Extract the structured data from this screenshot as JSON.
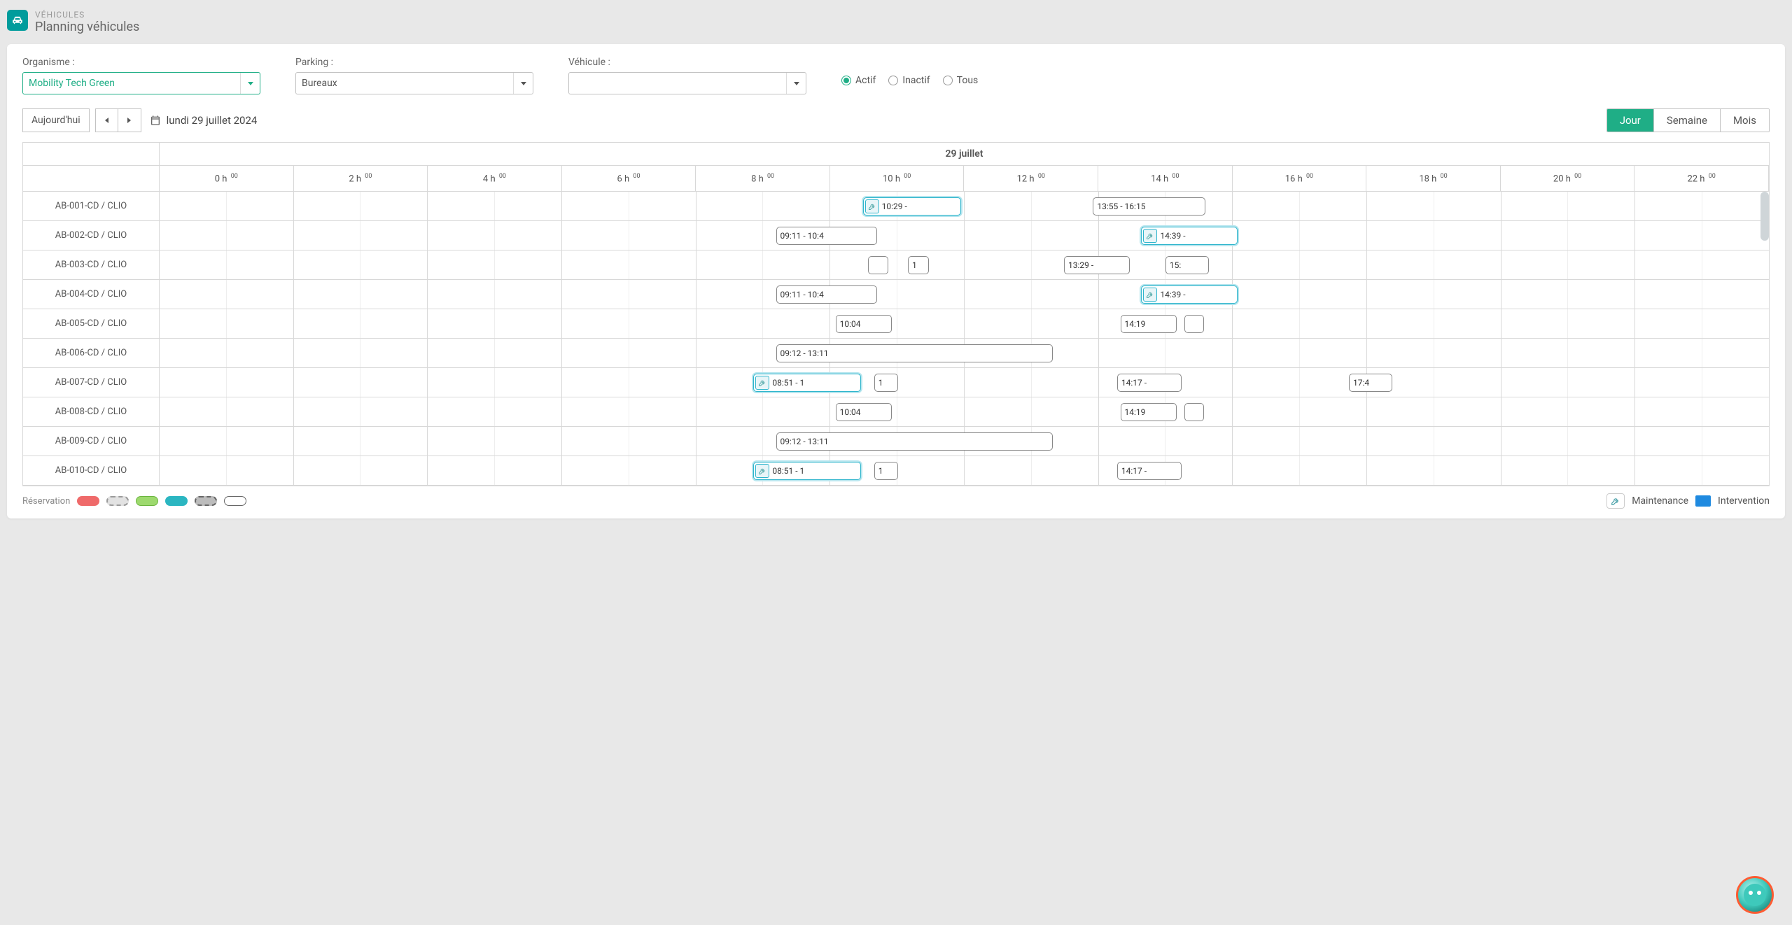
{
  "header": {
    "breadcrumb": "VÉHICULES",
    "title": "Planning véhicules"
  },
  "filters": {
    "org": {
      "label": "Organisme :",
      "value": "Mobility Tech Green"
    },
    "parking": {
      "label": "Parking :",
      "value": "Bureaux"
    },
    "vehicle": {
      "label": "Véhicule :",
      "value": ""
    },
    "radios": [
      {
        "label": "Actif",
        "checked": true
      },
      {
        "label": "Inactif",
        "checked": false
      },
      {
        "label": "Tous",
        "checked": false
      }
    ]
  },
  "toolbar": {
    "today": "Aujourd'hui",
    "date": "lundi 29 juillet 2024",
    "views": [
      "Jour",
      "Semaine",
      "Mois"
    ],
    "activeView": "Jour"
  },
  "scheduler": {
    "dayLabel": "29 juillet",
    "hours": [
      "0 h",
      "2 h",
      "4 h",
      "6 h",
      "8 h",
      "10 h",
      "12 h",
      "14 h",
      "16 h",
      "18 h",
      "20 h",
      "22 h"
    ],
    "hourSup": "00",
    "rows": [
      {
        "name": "AB-001-CD / CLIO",
        "bars": [
          {
            "label": "10:29 -",
            "startPct": 43.7,
            "widthPct": 6.1,
            "maint": true
          },
          {
            "label": "13:55 - 16:15",
            "startPct": 58.0,
            "widthPct": 7.0,
            "maint": false
          }
        ]
      },
      {
        "name": "AB-002-CD / CLIO",
        "bars": [
          {
            "label": "09:11 - 10:4",
            "startPct": 38.3,
            "widthPct": 6.3,
            "maint": false
          },
          {
            "label": "14:39 -",
            "startPct": 61.0,
            "widthPct": 6.0,
            "maint": true
          }
        ]
      },
      {
        "name": "AB-003-CD / CLIO",
        "bars": [
          {
            "label": "",
            "startPct": 44.0,
            "widthPct": 1.3,
            "maint": false
          },
          {
            "label": "1",
            "startPct": 46.5,
            "widthPct": 1.3,
            "maint": false
          },
          {
            "label": "13:29 -",
            "startPct": 56.2,
            "widthPct": 4.1,
            "maint": false
          },
          {
            "label": "15:",
            "startPct": 62.5,
            "widthPct": 2.7,
            "maint": false
          }
        ]
      },
      {
        "name": "AB-004-CD / CLIO",
        "bars": [
          {
            "label": "09:11 - 10:4",
            "startPct": 38.3,
            "widthPct": 6.3,
            "maint": false
          },
          {
            "label": "14:39 -",
            "startPct": 61.0,
            "widthPct": 6.0,
            "maint": true
          }
        ]
      },
      {
        "name": "AB-005-CD / CLIO",
        "bars": [
          {
            "label": "10:04",
            "startPct": 42.0,
            "widthPct": 3.5,
            "maint": false
          },
          {
            "label": "14:19",
            "startPct": 59.7,
            "widthPct": 3.5,
            "maint": false
          },
          {
            "label": "",
            "startPct": 63.7,
            "widthPct": 1.2,
            "maint": false
          }
        ]
      },
      {
        "name": "AB-006-CD / CLIO",
        "bars": [
          {
            "label": "09:12 - 13:11",
            "startPct": 38.3,
            "widthPct": 17.2,
            "maint": false
          }
        ]
      },
      {
        "name": "AB-007-CD / CLIO",
        "bars": [
          {
            "label": "08:51 - 1",
            "startPct": 36.9,
            "widthPct": 6.7,
            "maint": true
          },
          {
            "label": "1",
            "startPct": 44.4,
            "widthPct": 1.5,
            "maint": false
          },
          {
            "label": "14:17 -",
            "startPct": 59.5,
            "widthPct": 4.0,
            "maint": false
          },
          {
            "label": "17:4",
            "startPct": 73.9,
            "widthPct": 2.7,
            "maint": false
          }
        ]
      },
      {
        "name": "AB-008-CD / CLIO",
        "bars": [
          {
            "label": "10:04",
            "startPct": 42.0,
            "widthPct": 3.5,
            "maint": false
          },
          {
            "label": "14:19",
            "startPct": 59.7,
            "widthPct": 3.5,
            "maint": false
          },
          {
            "label": "",
            "startPct": 63.7,
            "widthPct": 1.2,
            "maint": false
          }
        ]
      },
      {
        "name": "AB-009-CD / CLIO",
        "bars": [
          {
            "label": "09:12 - 13:11",
            "startPct": 38.3,
            "widthPct": 17.2,
            "maint": false
          }
        ]
      },
      {
        "name": "AB-010-CD / CLIO",
        "bars": [
          {
            "label": "08:51 - 1",
            "startPct": 36.9,
            "widthPct": 6.7,
            "maint": true
          },
          {
            "label": "1",
            "startPct": 44.4,
            "widthPct": 1.5,
            "maint": false
          },
          {
            "label": "14:17 -",
            "startPct": 59.5,
            "widthPct": 4.0,
            "maint": false
          }
        ]
      }
    ]
  },
  "legend": {
    "reservation": "Réservation",
    "maintenance": "Maintenance",
    "intervention": "Intervention"
  }
}
